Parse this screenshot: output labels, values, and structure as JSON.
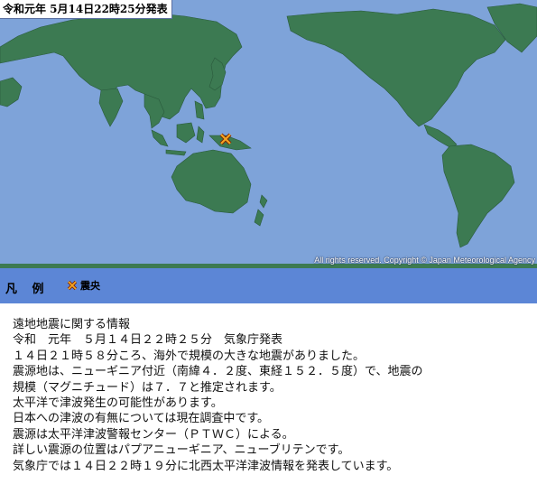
{
  "header": {
    "announcement": "令和元年  5月14日22時25分発表"
  },
  "map": {
    "copyright": "All rights reserved. Copyright © Japan Meteorological Agency",
    "colors": {
      "ocean": "#7ea3d9",
      "land": "#3c7a52",
      "epicenter": "#e8a020"
    }
  },
  "legend": {
    "title": "凡 例",
    "items": [
      {
        "icon": "epicenter-cross-icon",
        "label": "震央"
      }
    ]
  },
  "info": {
    "lines": [
      "遠地地震に関する情報",
      "令和　元年　５月１４日２２時２５分　気象庁発表",
      "１４日２１時５８分ころ、海外で規模の大きな地震がありました。",
      "震源地は、ニューギニア付近（南緯４．２度、東経１５２．５度）で、地震の",
      "規模（マグニチュード）は７．７と推定されます。",
      "太平洋で津波発生の可能性があります。",
      "日本への津波の有無については現在調査中です。",
      "震源は太平洋津波警報センター（ＰＴＷＣ）による。",
      "詳しい震源の位置はパプアニューギニア、ニューブリテンです。",
      "気象庁では１４日２２時１９分に北西太平洋津波情報を発表しています。"
    ]
  }
}
